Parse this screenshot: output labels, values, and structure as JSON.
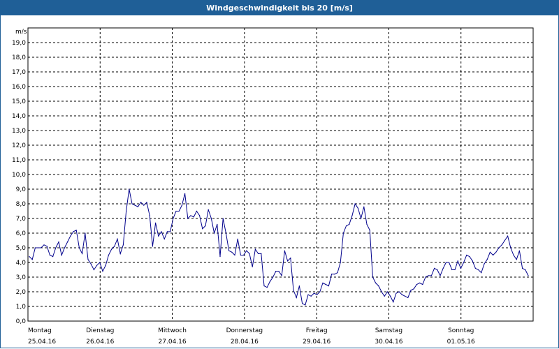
{
  "window": {
    "title": "Windgeschwindigkeit bis 20 [m/s]"
  },
  "chart_data": {
    "type": "line",
    "title": "Windgeschwindigkeit bis 20 [m/s]",
    "ylabel": "m/s",
    "ylim": [
      0,
      20
    ],
    "yticks": [
      "0,0",
      "1,0",
      "2,0",
      "3,0",
      "4,0",
      "5,0",
      "6,0",
      "7,0",
      "8,0",
      "9,0",
      "10,0",
      "11,0",
      "12,0",
      "13,0",
      "14,0",
      "15,0",
      "16,0",
      "17,0",
      "18,0",
      "19,0"
    ],
    "days": [
      {
        "name": "Montag",
        "date": "25.04.16"
      },
      {
        "name": "Dienstag",
        "date": "26.04.16"
      },
      {
        "name": "Mittwoch",
        "date": "27.04.16"
      },
      {
        "name": "Donnerstag",
        "date": "28.04.16"
      },
      {
        "name": "Freitag",
        "date": "29.04.16"
      },
      {
        "name": "Samstag",
        "date": "30.04.16"
      },
      {
        "name": "Sonntag",
        "date": "01.05.16"
      }
    ],
    "grid": true,
    "line_color": "#00008b",
    "series": [
      {
        "values": [
          4.4,
          4.2,
          5.0,
          5.0,
          5.0,
          5.2,
          5.1,
          4.5,
          4.4,
          5.0,
          5.4,
          4.5,
          5.0,
          5.4,
          5.8,
          6.1,
          6.2,
          5.0,
          4.6,
          6.0,
          4.2,
          3.9,
          3.5,
          3.8,
          4.0,
          3.4,
          3.8,
          4.5,
          4.9,
          5.1,
          5.6,
          4.6,
          5.2,
          7.5,
          9.0,
          8.0,
          7.9,
          7.8,
          8.1,
          7.9,
          8.1,
          7.2,
          5.1,
          6.7,
          5.8,
          6.1,
          5.6,
          6.1,
          6.1,
          7.0,
          7.5,
          7.5,
          7.9,
          8.7,
          7.0,
          7.2,
          7.1,
          7.5,
          7.2,
          6.3,
          6.5,
          7.6,
          7.0,
          6.0,
          6.6,
          4.4,
          7.0,
          6.0,
          4.8,
          4.7,
          4.5,
          5.6,
          4.5,
          4.5,
          4.8,
          4.6,
          3.7,
          4.9,
          4.6,
          4.6,
          2.4,
          2.3,
          2.7,
          3.0,
          3.4,
          3.4,
          3.1,
          4.8,
          4.1,
          4.3,
          2.1,
          1.6,
          2.4,
          1.2,
          1.1,
          1.8,
          1.7,
          1.9,
          1.8,
          2.0,
          2.6,
          2.5,
          2.4,
          3.2,
          3.2,
          3.3,
          4.0,
          6.0,
          6.5,
          6.6,
          7.2,
          8.0,
          7.7,
          7.0,
          7.8,
          6.6,
          6.2,
          3.0,
          2.6,
          2.4,
          2.0,
          1.7,
          2.0,
          1.7,
          1.3,
          1.9,
          2.0,
          1.8,
          1.7,
          1.6,
          2.1,
          2.2,
          2.5,
          2.6,
          2.5,
          3.0,
          3.1,
          3.1,
          3.6,
          3.5,
          3.1,
          3.6,
          4.0,
          4.0,
          3.5,
          3.5,
          4.1,
          3.6,
          4.0,
          4.5,
          4.4,
          4.1,
          3.6,
          3.5,
          3.3,
          3.9,
          4.2,
          4.7,
          4.5,
          4.7,
          5.0,
          5.2,
          5.5,
          5.8,
          5.0,
          4.5,
          4.2,
          4.8,
          3.6,
          3.5,
          3.1
        ]
      }
    ]
  }
}
